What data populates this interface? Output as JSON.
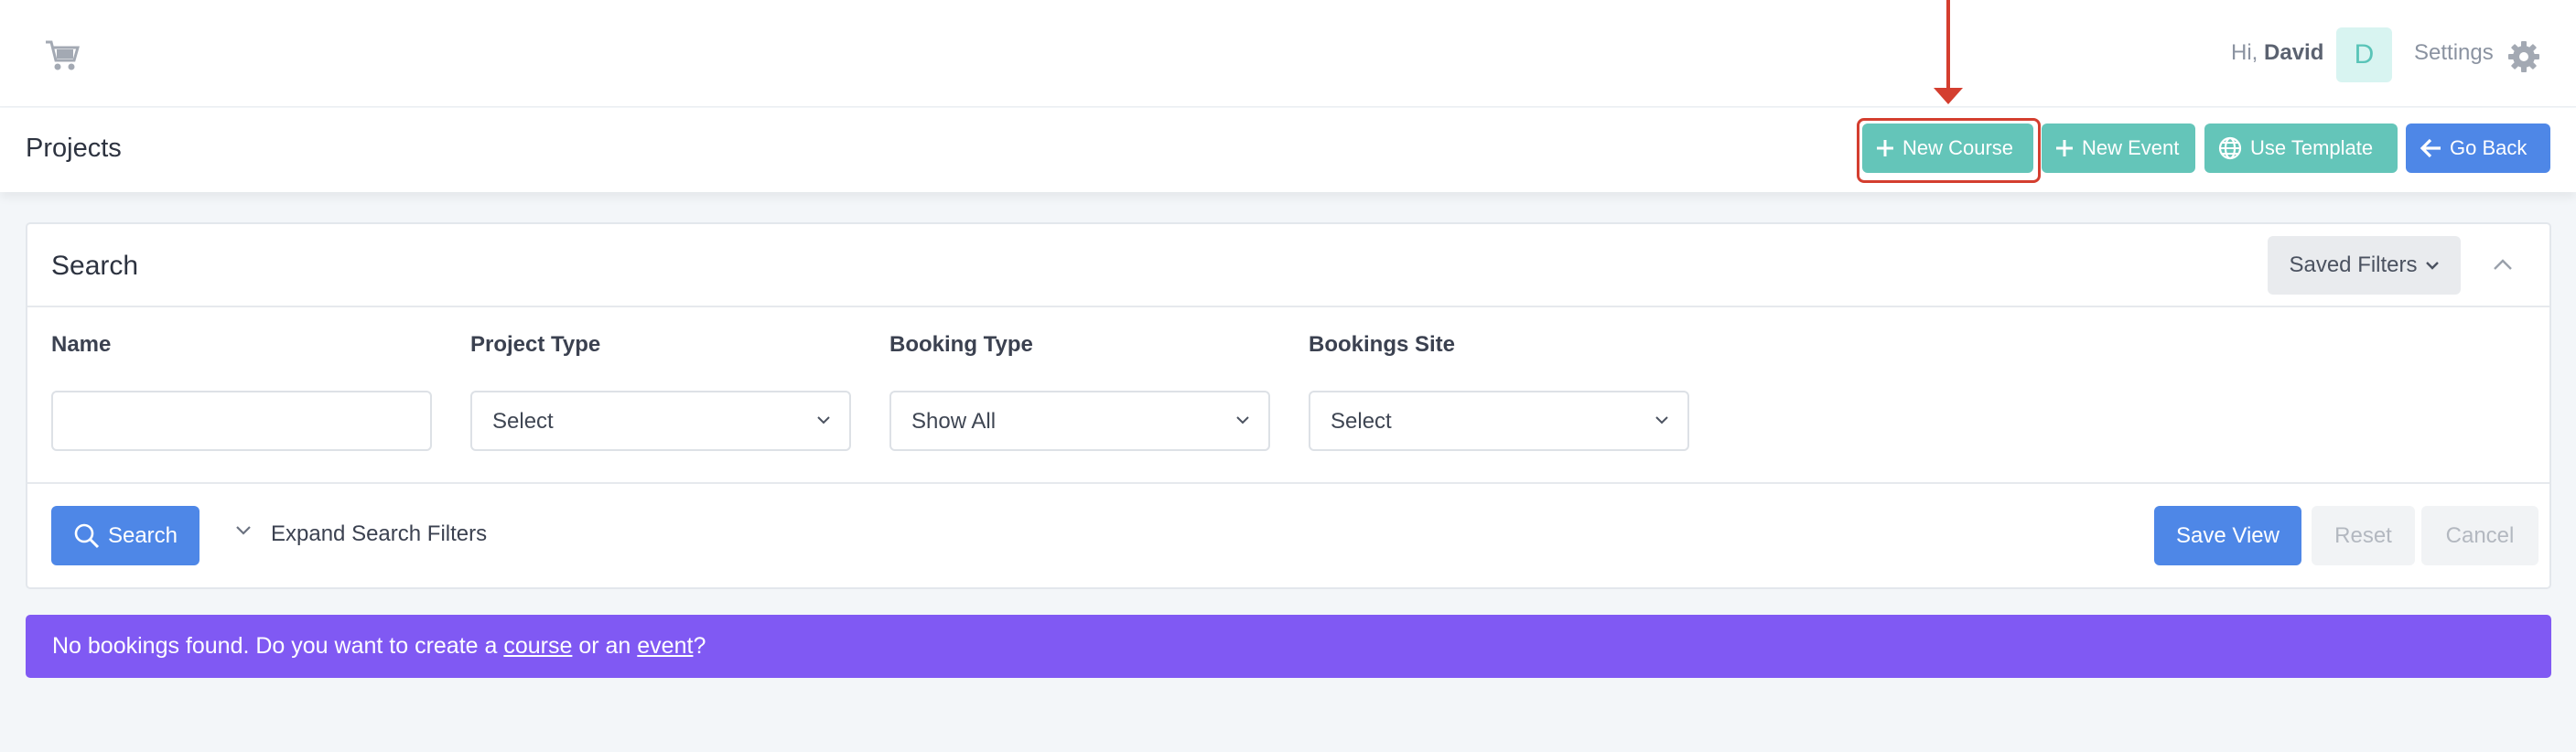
{
  "topbar": {
    "logo_icon": "cart-icon",
    "greeting_prefix": "Hi,",
    "user_name": "David",
    "avatar_initial": "D",
    "settings_label": "Settings",
    "settings_icon": "gear-icon"
  },
  "header": {
    "title": "Projects",
    "buttons": {
      "new_course": "New Course",
      "new_event": "New Event",
      "use_template": "Use Template",
      "go_back": "Go Back"
    },
    "annotation": {
      "color": "#d43e2f",
      "highlighted": "New Course"
    }
  },
  "search": {
    "title": "Search",
    "saved_filters": "Saved Filters",
    "fields": {
      "name_label": "Name",
      "name_value": "",
      "project_type_label": "Project Type",
      "project_type_value": "Select",
      "booking_type_label": "Booking Type",
      "booking_type_value": "Show All",
      "bookings_site_label": "Bookings Site",
      "bookings_site_value": "Select"
    },
    "search_button": "Search",
    "expand_filters": "Expand Search Filters",
    "save_view": "Save View",
    "reset": "Reset",
    "cancel": "Cancel"
  },
  "banner": {
    "text_before": "No bookings found. Do you want to create a ",
    "course_link": "course",
    "text_middle": " or an ",
    "event_link": "event",
    "text_after": "?",
    "color": "#8059f3"
  },
  "colors": {
    "teal": "#64c5b9",
    "blue": "#4e87e7",
    "purple": "#8059f3"
  }
}
